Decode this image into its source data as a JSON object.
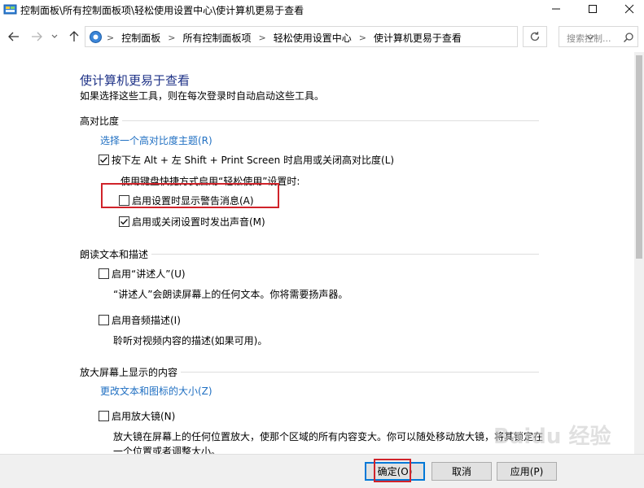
{
  "window": {
    "title": "控制面板\\所有控制面板项\\轻松使用设置中心\\使计算机更易于查看"
  },
  "address": {
    "crumbs": [
      "控制面板",
      "所有控制面板项",
      "轻松使用设置中心",
      "使计算机更易于查看"
    ],
    "separator": ">",
    "search_placeholder": "搜索控制..."
  },
  "page": {
    "title": "使计算机更易于查看",
    "description": "如果选择这些工具，则在每次登录时自动启动这些工具。"
  },
  "high_contrast": {
    "heading": "高对比度",
    "theme_link": "选择一个高对比度主题(R)",
    "toggle_shortcut": {
      "label": "按下左 Alt + 左 Shift + Print Screen 时启用或关闭高对比度(L)",
      "checked": true
    },
    "shortcut_note": "使用键盘快捷方式启用“轻松使用”设置时:",
    "show_warning": {
      "label": "启用设置时显示警告消息(A)",
      "checked": false
    },
    "make_sound": {
      "label": "启用或关闭设置时发出声音(M)",
      "checked": true
    }
  },
  "narration": {
    "heading": "朗读文本和描述",
    "narrator": {
      "label": "启用“讲述人”(U)",
      "checked": false
    },
    "narrator_desc": "“讲述人”会朗读屏幕上的任何文本。你将需要扬声器。",
    "audio_desc": {
      "label": "启用音频描述(I)",
      "checked": false
    },
    "audio_desc_text": "聆听对视频内容的描述(如果可用)。"
  },
  "magnify": {
    "heading": "放大屏幕上显示的内容",
    "size_link": "更改文本和图标的大小(Z)",
    "magnifier": {
      "label": "启用放大镜(N)",
      "checked": false
    },
    "magnifier_desc_1": "放大镜在屏幕上的任何位置放大，使那个区域的所有内容变大。你可以随处移动放大镜，将其锁定在",
    "magnifier_desc_2": "一个位置或者调整大小。"
  },
  "buttons": {
    "ok": "确定(O)",
    "cancel": "取消",
    "apply": "应用(P)"
  },
  "watermark": "Baidu 经验",
  "colors": {
    "title_blue": "#1e3287",
    "link_blue": "#1f6fc2",
    "highlight_red": "#d0232a"
  }
}
